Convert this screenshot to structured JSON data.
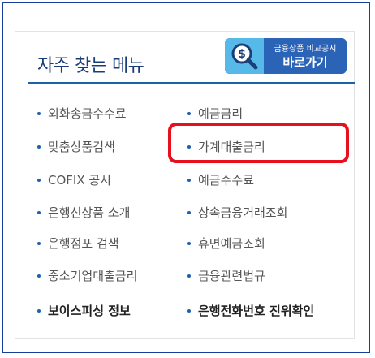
{
  "title": "자주 찾는 메뉴",
  "banner": {
    "line1": "금융상품 비교공시",
    "line2": "바로가기",
    "icon": "dollar-magnifier-icon"
  },
  "menu": {
    "left": [
      "외화송금수수료",
      "맞춤상품검색",
      "COFIX 공시",
      "은행신상품 소개",
      "은행점포 검색",
      "중소기업대출금리",
      "보이스피싱 정보"
    ],
    "right": [
      "예금금리",
      "가계대출금리",
      "예금수수료",
      "상속금융거래조회",
      "휴면예금조회",
      "금융관련법규",
      "은행전화번호 진위확인"
    ]
  },
  "colors": {
    "frame": "#1a3d9c",
    "title": "#1a3d78",
    "divider": "#1e61a9",
    "banner": "#2b63b6",
    "banner_icon_bg": "#56b9e8",
    "highlight": "#e8101a"
  }
}
